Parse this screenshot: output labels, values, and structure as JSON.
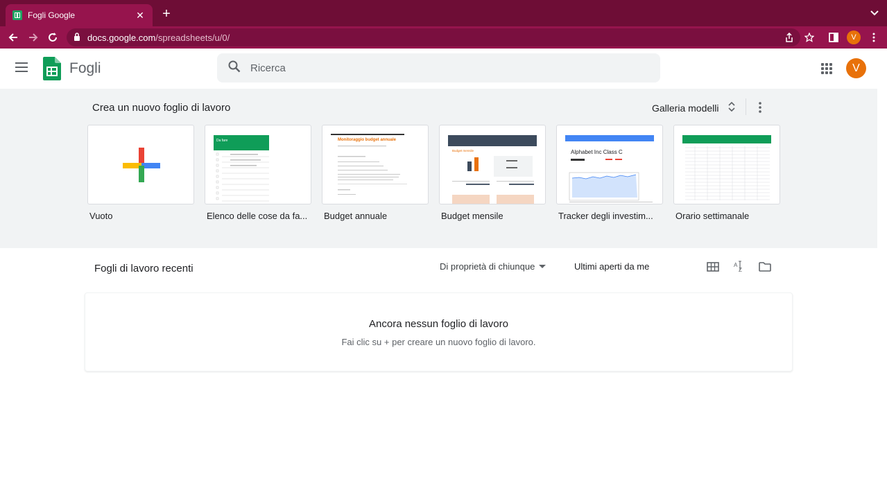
{
  "browser": {
    "tab_title": "Fogli Google",
    "tab_close": "✕",
    "new_tab": "+",
    "url_domain": "docs.google.com",
    "url_path": "/spreadsheets/u/0/",
    "profile_initial": "V"
  },
  "header": {
    "app_name": "Fogli",
    "search_placeholder": "Ricerca",
    "avatar_initial": "V"
  },
  "gallery": {
    "title": "Crea un nuovo foglio di lavoro",
    "gallery_link": "Galleria modelli",
    "templates": [
      {
        "label": "Vuoto",
        "thumb_title": ""
      },
      {
        "label": "Elenco delle cose da fa...",
        "thumb_title": "Da fare"
      },
      {
        "label": "Budget annuale",
        "thumb_title": "Monitoraggio budget annuale"
      },
      {
        "label": "Budget mensile",
        "thumb_title": "Budget mensile"
      },
      {
        "label": "Tracker degli investim...",
        "thumb_title": "Alphabet Inc Class C"
      },
      {
        "label": "Orario settimanale",
        "thumb_title": ""
      }
    ]
  },
  "recent": {
    "title": "Fogli di lavoro recenti",
    "owner_filter": "Di proprietà di chiunque",
    "sort_label": "Ultimi aperti da me",
    "empty_title": "Ancora nessun foglio di lavoro",
    "empty_subtitle": "Fai clic su + per creare un nuovo foglio di lavoro."
  },
  "colors": {
    "chrome_bg": "#6e0d36",
    "chrome_active": "#96144d",
    "sheets_green": "#0f9d58",
    "avatar": "#e8710a"
  }
}
